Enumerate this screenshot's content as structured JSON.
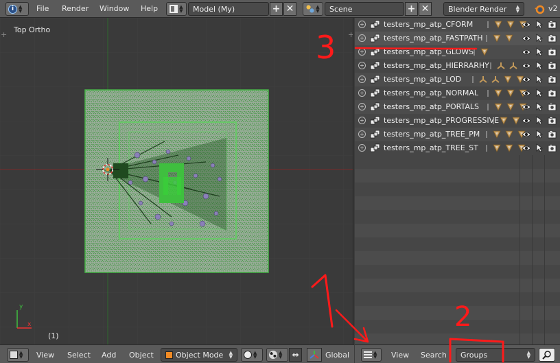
{
  "header": {
    "menu": [
      "File",
      "Render",
      "Window",
      "Help"
    ],
    "screen_layout": "Model (My)",
    "scene": "Scene",
    "render_engine": "Blender Render",
    "version_text": "v2"
  },
  "viewport": {
    "title": "Top Ortho",
    "frame_count": "(1)",
    "footer": {
      "menu": [
        "View",
        "Select",
        "Add",
        "Object"
      ],
      "mode": "Object Mode",
      "orientation": "Global"
    }
  },
  "outliner": {
    "rows": [
      {
        "label": "testers_mp_atp_CFORM"
      },
      {
        "label": "testers_mp_atp_FASTPATH"
      },
      {
        "label": "testers_mp_atp_GLOWS"
      },
      {
        "label": "testers_mp_atp_HIERRARHY"
      },
      {
        "label": "testers_mp_atp_LOD"
      },
      {
        "label": "testers_mp_atp_NORMAL"
      },
      {
        "label": "testers_mp_atp_PORTALS"
      },
      {
        "label": "testers_mp_atp_PROGRESSIVE"
      },
      {
        "label": "testers_mp_atp_TREE_PM"
      },
      {
        "label": "testers_mp_atp_TREE_ST"
      }
    ],
    "footer": {
      "view": "View",
      "search": "Search",
      "display_mode": "Groups"
    }
  },
  "annotations": [
    "1",
    "2",
    "3"
  ],
  "colors": {
    "annotation": "#ff1a1a",
    "highlight_underline": "#ff1a1a"
  }
}
